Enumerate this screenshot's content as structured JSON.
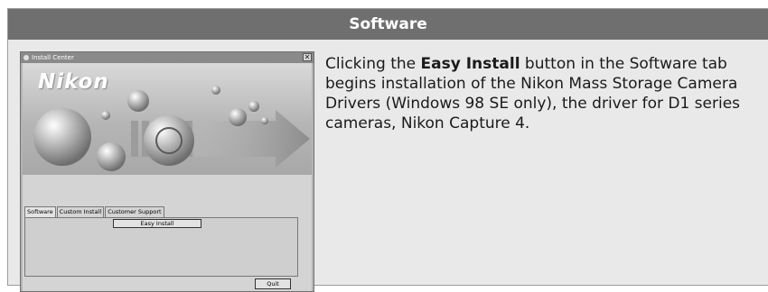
{
  "header": {
    "title": "Software"
  },
  "screenshot": {
    "window_title": "Install Center",
    "close_glyph": "✕",
    "logo_text": "Nikon",
    "tabs": [
      {
        "label": "Software",
        "active": true
      },
      {
        "label": "Custom Install",
        "active": false
      },
      {
        "label": "Customer Support",
        "active": false
      }
    ],
    "easy_install_label": "Easy Install",
    "quit_label": "Quit"
  },
  "description": {
    "part1": "Clicking the ",
    "bold": "Easy Install",
    "part2": " button in the Software tab begins installation of the Nikon Mass Storage Camera Drivers (Windows 98 SE only), the driver for D1 series cameras, Nikon Capture 4."
  }
}
